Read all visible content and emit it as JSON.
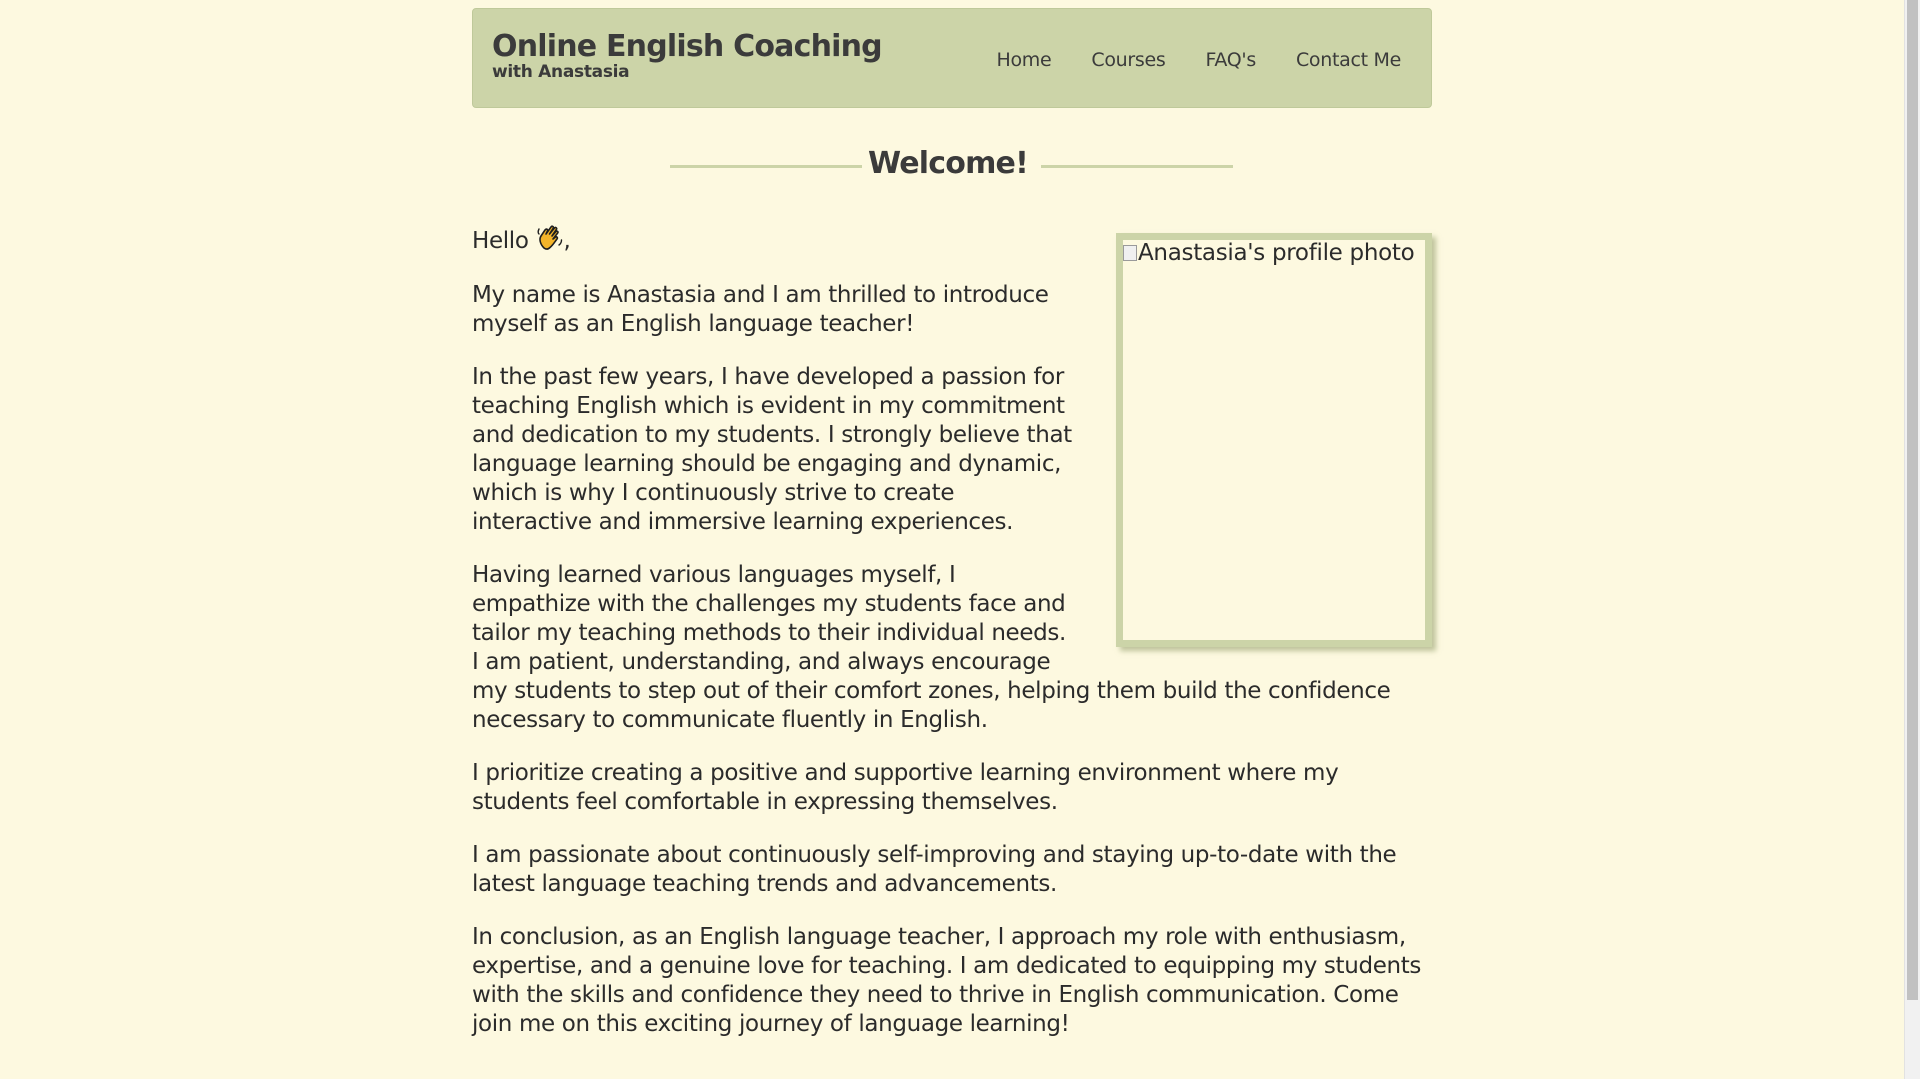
{
  "site": {
    "title": "Online English Coaching",
    "subtitle": "with Anastasia"
  },
  "nav": {
    "items": [
      {
        "label": "Home"
      },
      {
        "label": "Courses"
      },
      {
        "label": "FAQ's"
      },
      {
        "label": "Contact Me"
      }
    ]
  },
  "welcome": {
    "heading": "Welcome!"
  },
  "photo": {
    "alt": "Anastasia's profile photo"
  },
  "content": {
    "greeting": "Hello",
    "greeting_suffix": ",",
    "greeting_icon": "waving-hand-icon",
    "paragraphs": [
      "My name is Anastasia and I am thrilled to introduce myself as an English language teacher!",
      "In the past few years, I have developed a passion for teaching English which is evident in my commitment and dedication to my students. I strongly believe that language learning should be engaging and dynamic, which is why I continuously strive to create interactive and immersive learning experiences.",
      "Having learned various languages myself, I empathize with the challenges my students face and tailor my teaching methods to their individual needs. I am patient, understanding, and always encourage my students to step out of their comfort zones, helping them build the confidence necessary to communicate fluently in English.",
      "I prioritize creating a positive and supportive learning environment where my students feel comfortable in expressing themselves.",
      "I am passionate about continuously self-improving and staying up-to-date with the latest language teaching trends and advancements.",
      "In conclusion, as an English language teacher, I approach my role with enthusiasm, expertise, and a genuine love for teaching. I am dedicated to equipping my students with the skills and confidence they need to thrive in English communication. Come join me on this exciting journey of language learning!"
    ]
  },
  "colors": {
    "background": "#fdf9e0",
    "accent": "#ccd4a8",
    "text": "#2b2b2b"
  }
}
